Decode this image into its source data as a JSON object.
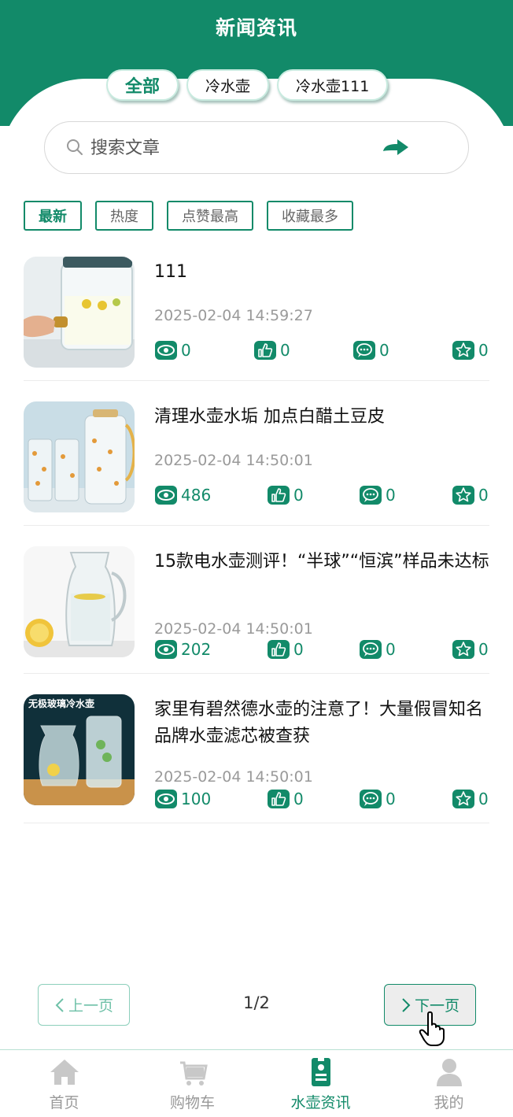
{
  "header": {
    "title": "新闻资讯"
  },
  "category_tabs": [
    {
      "label": "全部",
      "active": true
    },
    {
      "label": "冷水壶",
      "active": false
    },
    {
      "label": "冷水壶111",
      "active": false
    }
  ],
  "search": {
    "placeholder": "搜索文章",
    "value": ""
  },
  "sort_tabs": [
    {
      "label": "最新",
      "active": true
    },
    {
      "label": "热度",
      "active": false
    },
    {
      "label": "点赞最高",
      "active": false
    },
    {
      "label": "收藏最多",
      "active": false
    }
  ],
  "articles": [
    {
      "title": "111",
      "date": "2025-02-04 14:59:27",
      "views": "0",
      "likes": "0",
      "comments": "0",
      "favorites": "0"
    },
    {
      "title": "清理水壶水垢 加点白醋土豆皮",
      "date": "2025-02-04 14:50:01",
      "views": "486",
      "likes": "0",
      "comments": "0",
      "favorites": "0"
    },
    {
      "title": "15款电水壶测评！“半球”“恒滨”样品未达标",
      "date": "2025-02-04 14:50:01",
      "views": "202",
      "likes": "0",
      "comments": "0",
      "favorites": "0"
    },
    {
      "title": "家里有碧然德水壶的注意了！大量假冒知名品牌水壶滤芯被查获",
      "date": "2025-02-04 14:50:01",
      "views": "100",
      "likes": "0",
      "comments": "0",
      "favorites": "0"
    }
  ],
  "pagination": {
    "prev_label": "上一页",
    "next_label": "下一页",
    "page_info": "1/2"
  },
  "bottom_nav": [
    {
      "label": "首页",
      "icon": "home-icon",
      "active": false
    },
    {
      "label": "购物车",
      "icon": "cart-icon",
      "active": false
    },
    {
      "label": "水壶资讯",
      "icon": "news-icon",
      "active": true
    },
    {
      "label": "我的",
      "icon": "user-icon",
      "active": false
    }
  ],
  "colors": {
    "primary": "#128a69",
    "muted": "#999999"
  },
  "thumbnail_text": {
    "article_4": "无极玻璃冷水壶"
  }
}
